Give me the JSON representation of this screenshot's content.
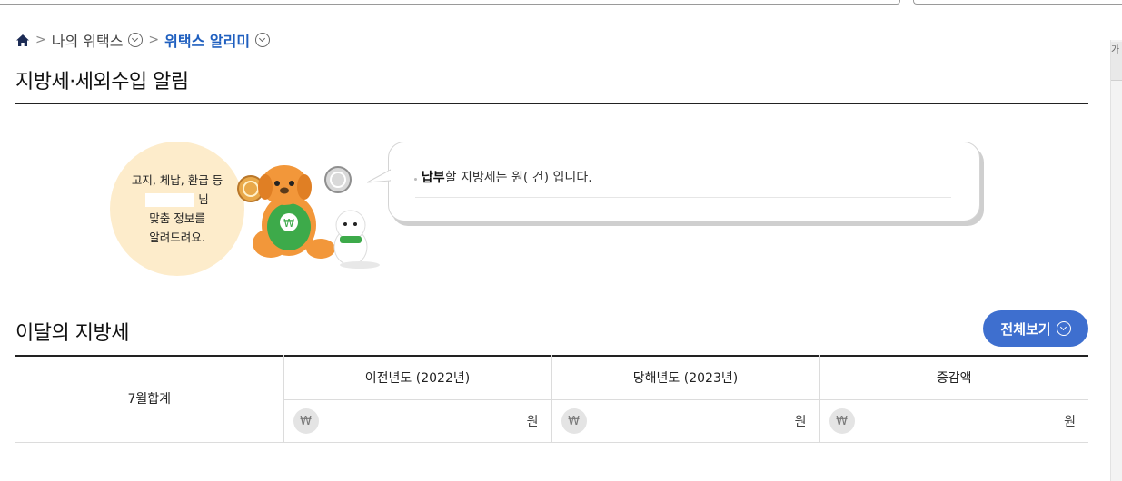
{
  "breadcrumb": {
    "home_icon": "home-icon",
    "items": [
      {
        "label": "나의 위택스"
      },
      {
        "label": "위택스 알리미"
      }
    ]
  },
  "page_title": "지방세·세외수입 알림",
  "info": {
    "circle_lines": [
      "고지, 체납, 환급 등",
      "님",
      "맞춤 정보를",
      "알려드려요."
    ],
    "speech": {
      "bold": "납부",
      "text": "할 지방세는   원(   건) 입니다."
    }
  },
  "monthly": {
    "title": "이달의 지방세",
    "view_all_label": "전체보기",
    "table": {
      "row_header": "7월합계",
      "columns": [
        "이전년도 (2022년)",
        "당해년도 (2023년)",
        "증감액"
      ],
      "currency_symbol": "₩",
      "unit": "원"
    }
  },
  "scrollbar": {
    "thumb_label": "가"
  },
  "colors": {
    "accent": "#3e6fcf",
    "breadcrumb_current": "#1f5fbf",
    "bubble": "#fdeccb",
    "mascot_orange": "#f2973a",
    "mascot_green": "#3daa4a"
  }
}
